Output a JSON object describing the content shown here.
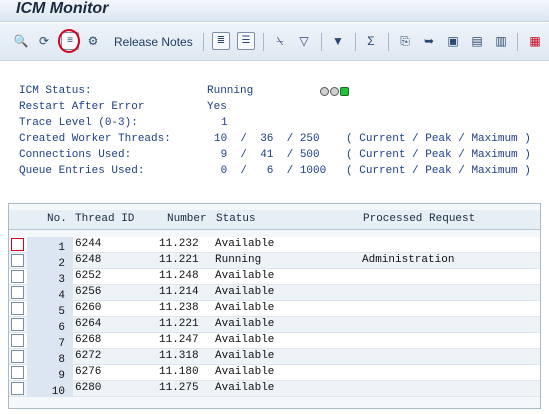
{
  "window": {
    "title": "ICM Monitor"
  },
  "toolbar": {
    "release_notes_label": "Release Notes",
    "icons": [
      "refresh-icon",
      "reload-icon",
      "details-icon",
      "settings-icon",
      "local-file-icon",
      "view-details-icon",
      "print-icon",
      "filter-table-icon",
      "filter-icon",
      "sum-icon",
      "export-icon",
      "send-icon",
      "save-icon",
      "layout-icon",
      "select-layout-icon",
      "grid-icon"
    ]
  },
  "status": {
    "icm_status_label": "ICM Status:",
    "icm_status_value": "Running",
    "restart_label": "Restart After Error",
    "restart_value": "Yes",
    "trace_label": "Trace Level (0-3):",
    "trace_value": "1",
    "threads_label": "Created Worker Threads:",
    "threads_value": "10  /  36  / 250    ( Current / Peak / Maximum )",
    "connections_label": "Connections Used:",
    "connections_value": " 9  /  41  / 500    ( Current / Peak / Maximum )",
    "queue_label": "Queue Entries Used:",
    "queue_value": " 0  /   6  / 1000   ( Current / Peak / Maximum )",
    "lights": [
      "gray",
      "gray",
      "green"
    ]
  },
  "table": {
    "headers": {
      "no": "No.",
      "thread_id": "Thread ID",
      "number": "Number",
      "status": "Status",
      "processed": "Processed Request"
    },
    "rows": [
      {
        "no": "1",
        "thread_id": "6244",
        "number": "11.232",
        "status": "Available",
        "processed": ""
      },
      {
        "no": "2",
        "thread_id": "6248",
        "number": "11.221",
        "status": "Running",
        "processed": "Administration"
      },
      {
        "no": "3",
        "thread_id": "6252",
        "number": "11.248",
        "status": "Available",
        "processed": ""
      },
      {
        "no": "4",
        "thread_id": "6256",
        "number": "11.214",
        "status": "Available",
        "processed": ""
      },
      {
        "no": "5",
        "thread_id": "6260",
        "number": "11.238",
        "status": "Available",
        "processed": ""
      },
      {
        "no": "6",
        "thread_id": "6264",
        "number": "11.221",
        "status": "Available",
        "processed": ""
      },
      {
        "no": "7",
        "thread_id": "6268",
        "number": "11.247",
        "status": "Available",
        "processed": ""
      },
      {
        "no": "8",
        "thread_id": "6272",
        "number": "11.318",
        "status": "Available",
        "processed": ""
      },
      {
        "no": "9",
        "thread_id": "6276",
        "number": "11.180",
        "status": "Available",
        "processed": ""
      },
      {
        "no": "10",
        "thread_id": "6280",
        "number": "11.275",
        "status": "Available",
        "processed": ""
      }
    ]
  }
}
